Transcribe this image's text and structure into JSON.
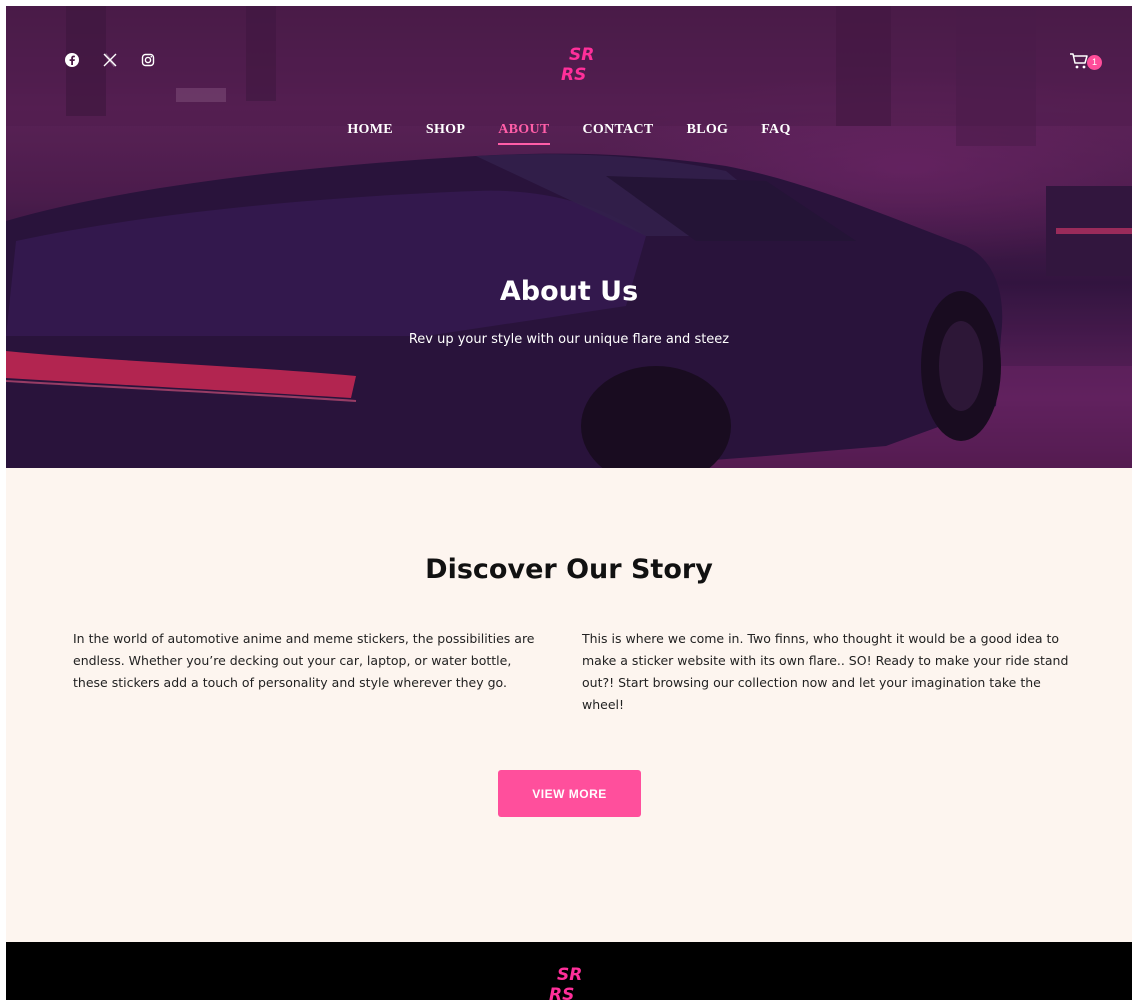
{
  "header": {
    "social_icons": [
      "facebook-icon",
      "x-icon",
      "instagram-icon"
    ],
    "logo_icon": "srrs-logo",
    "logo_text_top": "SR",
    "logo_text_bottom": "RS",
    "cart_icon": "cart-icon",
    "cart_count": "1"
  },
  "nav": {
    "items": [
      {
        "label": "HOME",
        "active": false
      },
      {
        "label": "SHOP",
        "active": false
      },
      {
        "label": "ABOUT",
        "active": true
      },
      {
        "label": "CONTACT",
        "active": false
      },
      {
        "label": "BLOG",
        "active": false
      },
      {
        "label": "FAQ",
        "active": false
      }
    ]
  },
  "hero": {
    "title": "About Us",
    "subtitle": "Rev up your style with our unique flare and steez"
  },
  "story": {
    "title": "Discover Our Story",
    "left_text": "In the world of automotive anime and meme stickers, the possibilities are endless. Whether you’re decking out your car, laptop, or water bottle, these stickers add a touch of personality and style wherever they go.",
    "right_text": "This is where we come in. Two finns, who thought it would be a good idea to make a sticker website with its own flare.. SO! Ready to make your ride stand out?! Start browsing our collection now and let your imagination take the wheel!",
    "button_label": "VIEW MORE"
  },
  "colors": {
    "accent": "#ff4f9c",
    "story_bg": "#fdf5ef",
    "footer_bg": "#000000"
  }
}
